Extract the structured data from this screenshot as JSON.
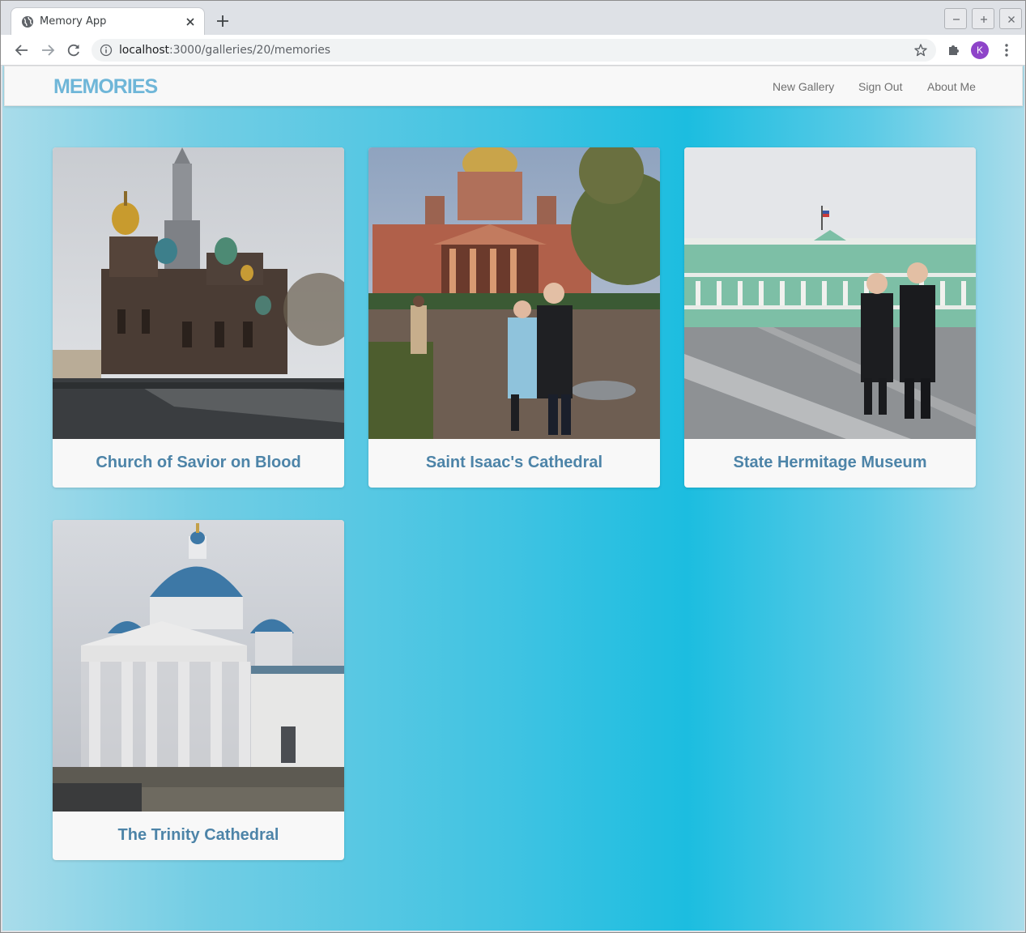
{
  "browser": {
    "tab_title": "Memory App",
    "url_host": "localhost",
    "url_path": ":3000/galleries/20/memories",
    "profile_initial": "K"
  },
  "app": {
    "brand": "MEMORIES",
    "nav": [
      {
        "label": "New Gallery"
      },
      {
        "label": "Sign Out"
      },
      {
        "label": "About Me"
      }
    ]
  },
  "memories": [
    {
      "title": "Church of Savior on Blood"
    },
    {
      "title": "Saint Isaac's Cathedral"
    },
    {
      "title": "State Hermitage Museum"
    },
    {
      "title": "The Trinity Cathedral"
    }
  ],
  "colors": {
    "brand": "#6fb6d8",
    "caption": "#4d84a8",
    "nav_text": "#707070",
    "profile": "#8e44c9",
    "background_accent": "#1cbde0"
  }
}
